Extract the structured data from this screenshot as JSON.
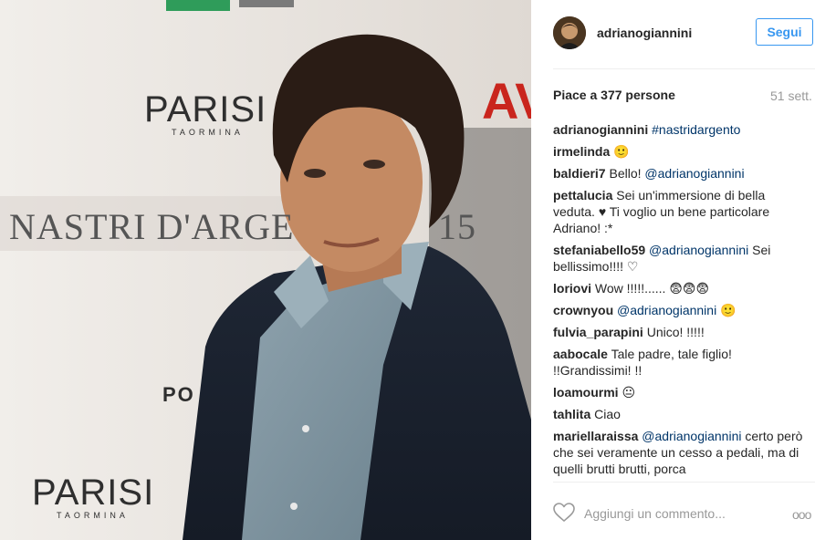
{
  "photo": {
    "wall_texts": [
      "PARISI",
      "TAORMINA",
      "NASTRI D'ARGE",
      "15",
      "AV",
      "PARISI",
      "TAORMINA",
      "PO"
    ]
  },
  "post": {
    "username": "adrianogiannini",
    "follow_label": "Segui",
    "likes": "Piace a 377 persone",
    "time": "51 sett."
  },
  "comments": [
    {
      "user": "adrianogiannini",
      "text": "",
      "mention": "#nastridargento",
      "after": ""
    },
    {
      "user": "irmelinda",
      "text": "🙂",
      "mention": "",
      "after": ""
    },
    {
      "user": "baldieri7",
      "text": "Bello! ",
      "mention": "@adrianogiannini",
      "after": ""
    },
    {
      "user": "pettalucia",
      "text": "Sei un'immersione di bella veduta. ♥ Ti voglio un bene particolare Adriano! :*",
      "mention": "",
      "after": ""
    },
    {
      "user": "stefaniabello59",
      "text": "",
      "mention": "@adrianogiannini",
      "after": " Sei bellissimo!!!! ♡"
    },
    {
      "user": "loriovi",
      "text": "Wow !!!!!...... 😨😨😨",
      "mention": "",
      "after": ""
    },
    {
      "user": "crownyou",
      "text": "",
      "mention": "@adrianogiannini",
      "after": " 🙂"
    },
    {
      "user": "fulvia_parapini",
      "text": "Unico! !!!!!",
      "mention": "",
      "after": ""
    },
    {
      "user": "aabocale",
      "text": "Tale padre, tale figlio! !!Grandissimi! !!",
      "mention": "",
      "after": ""
    },
    {
      "user": "loamourmi",
      "text": "😐",
      "mention": "",
      "after": ""
    },
    {
      "user": "tahlita",
      "text": "Ciao",
      "mention": "",
      "after": ""
    },
    {
      "user": "mariellaraissa",
      "text": "",
      "mention": "@adrianogiannini",
      "after": " certo però che sei veramente un cesso a pedali, ma di quelli brutti brutti, porca"
    }
  ],
  "comment_box": {
    "placeholder": "Aggiungi un commento...",
    "more_label": "ooo"
  },
  "icons": {
    "heart": "heart-icon",
    "avatar": "avatar"
  },
  "colors": {
    "link_blue": "#3897f0",
    "mention_blue": "#003569",
    "text": "#262626",
    "muted": "#999999"
  }
}
